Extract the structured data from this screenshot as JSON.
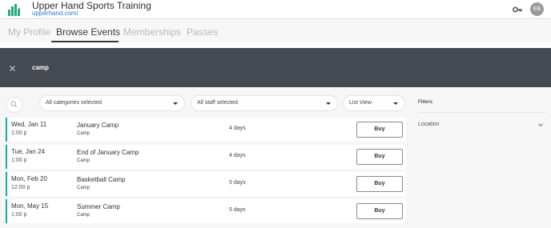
{
  "header": {
    "title": "Upper Hand Sports Training",
    "url": "upperhand.com/",
    "user_initials": "EB",
    "brand_color": "#27a978",
    "icons": [
      "logo-icon",
      "key-icon"
    ]
  },
  "tabs": [
    {
      "label": "My Profile",
      "active": false
    },
    {
      "label": "Browse Events",
      "active": true
    },
    {
      "label": "Memberships",
      "active": false
    },
    {
      "label": "Passes",
      "active": false
    }
  ],
  "search": {
    "query": "camp",
    "background": "#454a52"
  },
  "filters": {
    "category": "All categories selected",
    "staff": "All staff selected",
    "view": "List View"
  },
  "events": [
    {
      "date": "Wed, Jan 11",
      "time": "1:00 p",
      "name": "January Camp",
      "type": "Camp",
      "duration": "4 days",
      "action": "Buy"
    },
    {
      "date": "Tue, Jan 24",
      "time": "1:00 p",
      "name": "End of January Camp",
      "type": "Camp",
      "duration": "4 days",
      "action": "Buy"
    },
    {
      "date": "Mon, Feb 20",
      "time": "12:00 p",
      "name": "Basketball Camp",
      "type": "Camp",
      "duration": "5 days",
      "action": "Buy"
    },
    {
      "date": "Mon, May 15",
      "time": "1:00 p",
      "name": "Summer Camp",
      "type": "Camp",
      "duration": "5 days",
      "action": "Buy"
    }
  ],
  "sidebar": {
    "title": "Filters",
    "location_label": "Location"
  },
  "accent_color": "#2aa395"
}
